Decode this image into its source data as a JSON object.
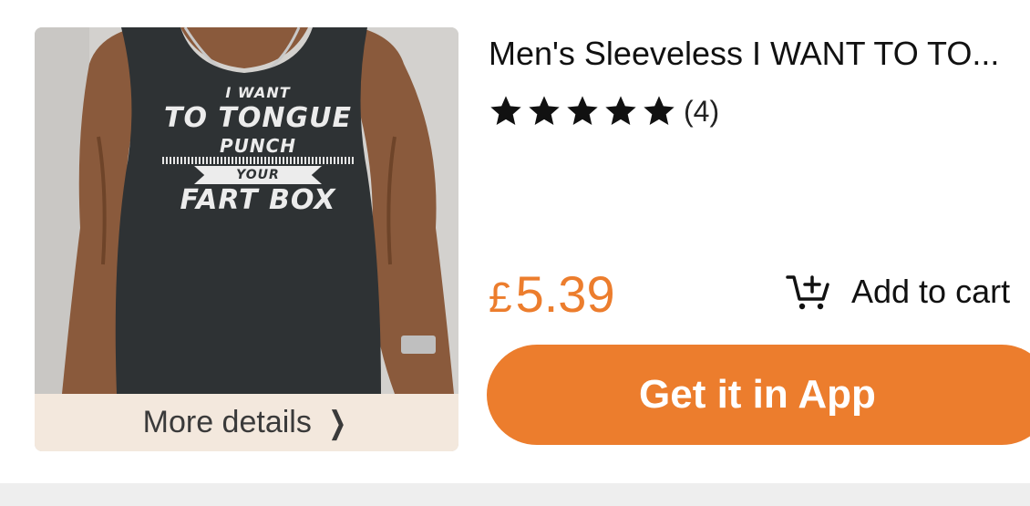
{
  "product": {
    "title": "Men's Sleeveless I WANT TO TO...",
    "rating": {
      "stars": 5,
      "count_label": "(4)"
    },
    "price": {
      "currency": "£",
      "amount": "5.39"
    },
    "shirt_print": {
      "line1": "I WANT",
      "line2": "TO TONGUE",
      "line3": "PUNCH",
      "line4": "YOUR",
      "line5": "FART BOX"
    },
    "more_details_label": "More details"
  },
  "actions": {
    "add_to_cart_label": "Add to cart",
    "get_app_label": "Get it in App"
  },
  "colors": {
    "accent": "#ec7d2d",
    "more_bar_bg": "#f3e8dd",
    "shirt": "#2e3234"
  },
  "icons": {
    "cart": "cart-plus-icon",
    "star": "star-icon",
    "chevron": "chevron-right-icon"
  }
}
